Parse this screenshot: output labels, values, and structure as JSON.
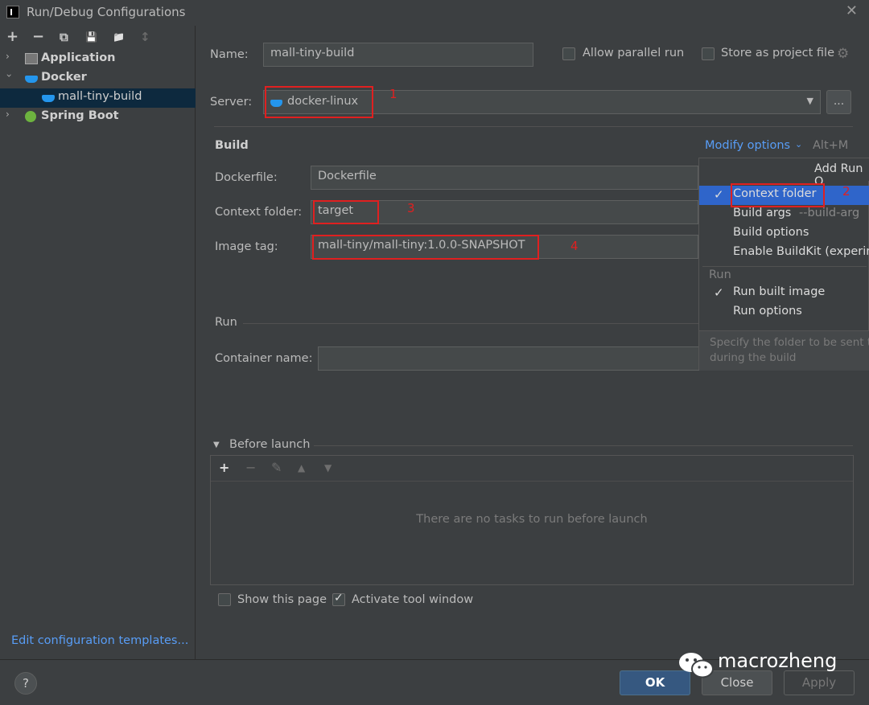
{
  "window": {
    "title": "Run/Debug Configurations"
  },
  "sidebar": {
    "toolbar": [
      "+",
      "−",
      "⧉",
      "💾",
      "📁",
      "↕"
    ],
    "tree": [
      {
        "label": "Application",
        "expanded": false,
        "icon": "application-icon"
      },
      {
        "label": "Docker",
        "expanded": true,
        "icon": "docker-icon"
      },
      {
        "label": "mall-tiny-build",
        "child": true,
        "selected": true,
        "icon": "docker-icon"
      },
      {
        "label": "Spring Boot",
        "expanded": false,
        "icon": "spring-boot-icon"
      }
    ],
    "edit_templates": "Edit configuration templates..."
  },
  "form": {
    "name_label": "Name:",
    "name_value": "mall-tiny-build",
    "allow_parallel": "Allow parallel run",
    "store_project": "Store as project file",
    "server_label": "Server:",
    "server_value": "docker-linux",
    "browse": "...",
    "build_section": "Build",
    "modify_options": "Modify options",
    "modify_shortcut": "Alt+M",
    "dockerfile_label": "Dockerfile:",
    "dockerfile_value": "Dockerfile",
    "context_label": "Context folder:",
    "context_value": "target",
    "image_tag_label": "Image tag:",
    "image_tag_value": "mall-tiny/mall-tiny:1.0.0-SNAPSHOT",
    "run_section": "Run",
    "container_label": "Container name:",
    "container_value": ""
  },
  "annotations": [
    "1",
    "2",
    "3",
    "4"
  ],
  "popup": {
    "header": "Add Run O",
    "items": [
      {
        "label": "Context folder",
        "checked": true,
        "highlighted": true
      },
      {
        "label": "Build args",
        "hint": "--build-arg",
        "checked": false
      },
      {
        "label": "Build options",
        "checked": false
      },
      {
        "label": "Enable BuildKit (experim",
        "checked": false
      }
    ],
    "run_group": "Run",
    "run_items": [
      {
        "label": "Run built image",
        "checked": true
      },
      {
        "label": "Run options",
        "checked": false
      }
    ],
    "footer_line1": "Specify the folder to be sent to",
    "footer_line2": "during the build"
  },
  "before_launch": {
    "title": "Before launch",
    "empty_text": "There are no tasks to run before launch",
    "show_page": "Show this page",
    "activate_tool": "Activate tool window"
  },
  "buttons": {
    "help": "?",
    "ok": "OK",
    "close": "Close",
    "apply": "Apply"
  },
  "watermark": "macrozheng",
  "colors": {
    "accent": "#589df6",
    "selection": "#2f65ca",
    "annotation": "#e02020",
    "ok_button": "#365880"
  }
}
